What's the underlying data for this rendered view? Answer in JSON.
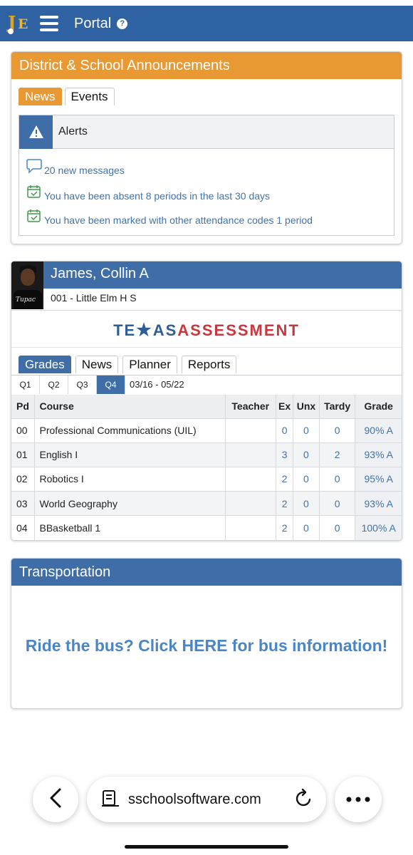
{
  "app": {
    "logo_text": "JE",
    "title": "Portal"
  },
  "announcements": {
    "title": "District & School Announcements",
    "tabs": [
      {
        "label": "News",
        "active": true
      },
      {
        "label": "Events",
        "active": false
      }
    ],
    "alerts_title": "Alerts",
    "alerts": [
      {
        "icon": "chat-bubble-icon",
        "text": "20 new messages"
      },
      {
        "icon": "calendar-check-icon",
        "text": "You have been absent 8 periods in the last 30 days"
      },
      {
        "icon": "calendar-check-icon",
        "text": "You have been marked with other attendance codes 1 period"
      }
    ]
  },
  "student": {
    "name": "James, Collin A",
    "school": "001 - Little Elm H S",
    "photo_shirt_text": "Tupac",
    "assessment_logo": {
      "part1": "TE",
      "part2": "AS",
      "part3": "ASSESSMENT"
    },
    "tabs": [
      {
        "label": "Grades",
        "active": true
      },
      {
        "label": "News",
        "active": false
      },
      {
        "label": "Planner",
        "active": false
      },
      {
        "label": "Reports",
        "active": false
      }
    ],
    "quarters": [
      {
        "label": "Q1",
        "active": false
      },
      {
        "label": "Q2",
        "active": false
      },
      {
        "label": "Q3",
        "active": false
      },
      {
        "label": "Q4",
        "active": true
      }
    ],
    "quarter_dates": "03/16 - 05/22",
    "columns": [
      "Pd",
      "Course",
      "Teacher",
      "Ex",
      "Unx",
      "Tardy",
      "Grade"
    ],
    "rows": [
      {
        "pd": "00",
        "course": "Professional Communications (UIL)",
        "teacher": "",
        "ex": "0",
        "unx": "0",
        "tardy": "0",
        "grade": "90% A"
      },
      {
        "pd": "01",
        "course": "English I",
        "teacher": "",
        "ex": "3",
        "unx": "0",
        "tardy": "2",
        "grade": "93% A"
      },
      {
        "pd": "02",
        "course": "Robotics I",
        "teacher": "",
        "ex": "2",
        "unx": "0",
        "tardy": "0",
        "grade": "95% A"
      },
      {
        "pd": "03",
        "course": "World Geography",
        "teacher": "",
        "ex": "2",
        "unx": "0",
        "tardy": "0",
        "grade": "93% A"
      },
      {
        "pd": "04",
        "course": "BBasketball 1",
        "teacher": "",
        "ex": "2",
        "unx": "0",
        "tardy": "0",
        "grade": "100% A"
      }
    ]
  },
  "transportation": {
    "title": "Transportation",
    "link_text": "Ride the bus? Click HERE for bus information!"
  },
  "browser": {
    "url": "sschoolsoftware.com"
  },
  "colors": {
    "header_blue": "#2f62a2",
    "panel_blue": "#3e6da7",
    "orange": "#e89934",
    "link_blue": "#3e73ad",
    "texas_red": "#c8373e"
  }
}
